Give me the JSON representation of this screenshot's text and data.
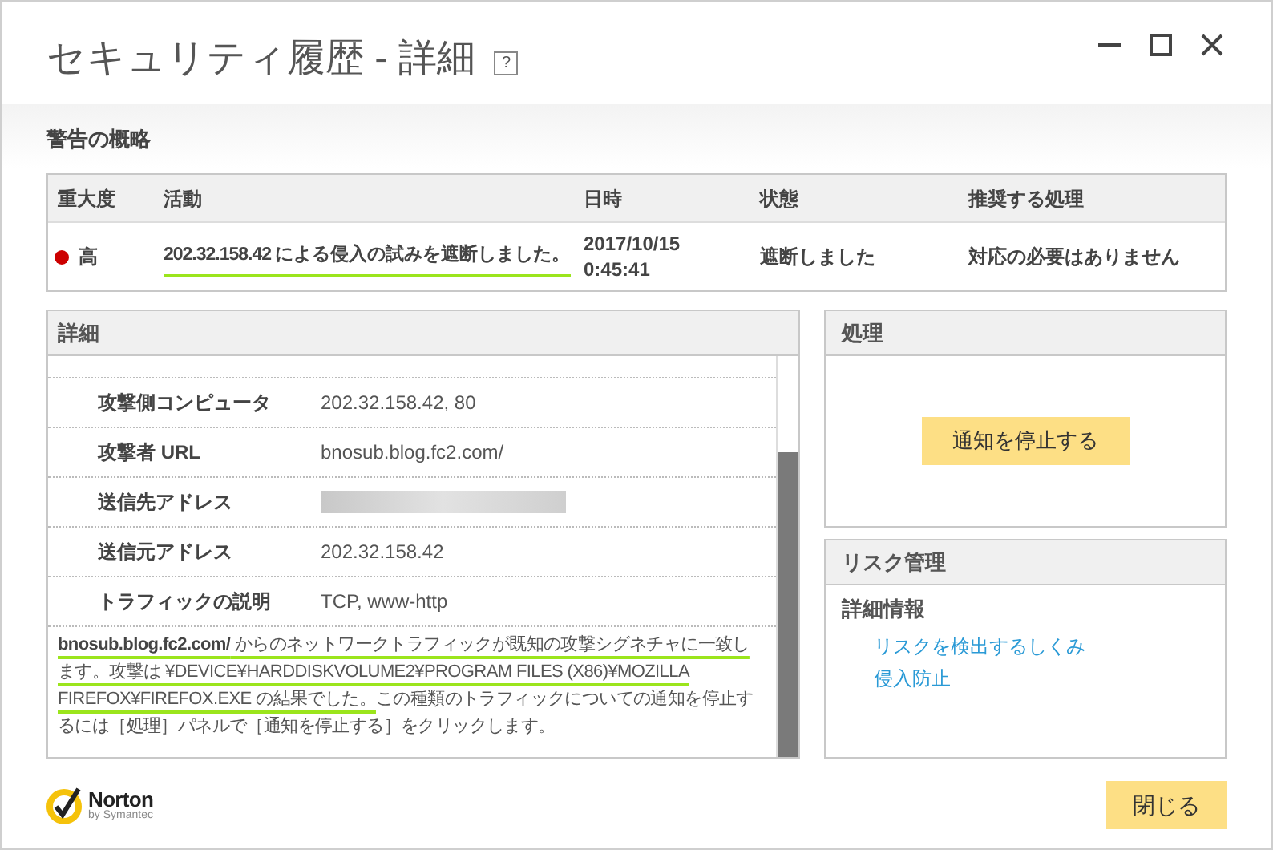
{
  "window": {
    "title": "セキュリティ履歴 - 詳細",
    "help": "?"
  },
  "summary": {
    "title": "警告の概略",
    "columns": [
      "重大度",
      "活動",
      "日時",
      "状態",
      "推奨する処理"
    ],
    "row": {
      "severity": {
        "label": "高",
        "color": "#cc0000"
      },
      "activity": "202.32.158.42 による侵入の試みを遮断しました。",
      "activity_marked": true,
      "datetime": [
        "2017/10/15",
        "0:45:41"
      ],
      "status": "遮断しました",
      "action": "対応の必要はありません"
    }
  },
  "details": {
    "title": "詳細",
    "rows": [
      {
        "label": "攻撃側コンピュータ",
        "value": "202.32.158.42, 80",
        "kind": "text"
      },
      {
        "label": "攻撃者 URL",
        "value": "bnosub.blog.fc2.com/",
        "kind": "text"
      },
      {
        "label": "送信先アドレス",
        "kind": "redacted"
      },
      {
        "label": "送信元アドレス",
        "value": "202.32.158.42",
        "kind": "text"
      },
      {
        "label": "トラフィックの説明",
        "value": "TCP, www-http",
        "kind": "text"
      }
    ],
    "description": [
      {
        "text": "**bnosub.blog.fc2.com/** からのネットワークトラフィックが既知の攻撃シグネチャに一致します。攻撃は ¥DEVICE¥HARDDISKVOLUME2¥PROGRAM FILES (X86)¥MOZILLA FIREFOX¥FIREFOX.EXE の結果でした。",
        "marked": true
      },
      {
        "text": "この種類のトラフィックについての通知を停止するには［処理］パネルで［通知を停止する］をクリックします。",
        "marked": false
      }
    ]
  },
  "actions": {
    "title": "処理",
    "button": "通知を停止する"
  },
  "risk": {
    "title": "リスク管理",
    "subtitle": "詳細情報",
    "links": [
      "リスクを検出するしくみ",
      "侵入防止"
    ]
  },
  "footer": {
    "logo_name": "Norton",
    "logo_sub": "by Symantec",
    "close": "閉じる"
  }
}
